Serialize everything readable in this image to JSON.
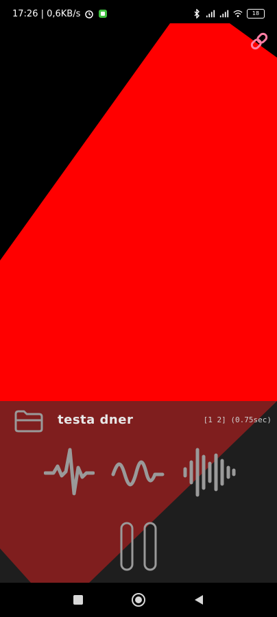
{
  "status_bar": {
    "time_speed": "17:26 | 0,6KB/s",
    "battery": "18"
  },
  "player": {
    "title": "testa dner",
    "meta": "[1 2] (0.75sec)"
  },
  "colors": {
    "background": "#000000",
    "shape": "#ff0000",
    "panel_overlay": "#303030",
    "icon_gray": "#9a9a9a"
  },
  "icons": {
    "link": "link-icon",
    "folder": "folder-icon",
    "waveform_1": "heartbeat-wave-icon",
    "waveform_2": "sine-wave-icon",
    "waveform_3": "audio-bars-icon",
    "pause": "pause-icon",
    "nav_recents": "recents-icon",
    "nav_home": "home-icon",
    "nav_back": "back-icon"
  }
}
